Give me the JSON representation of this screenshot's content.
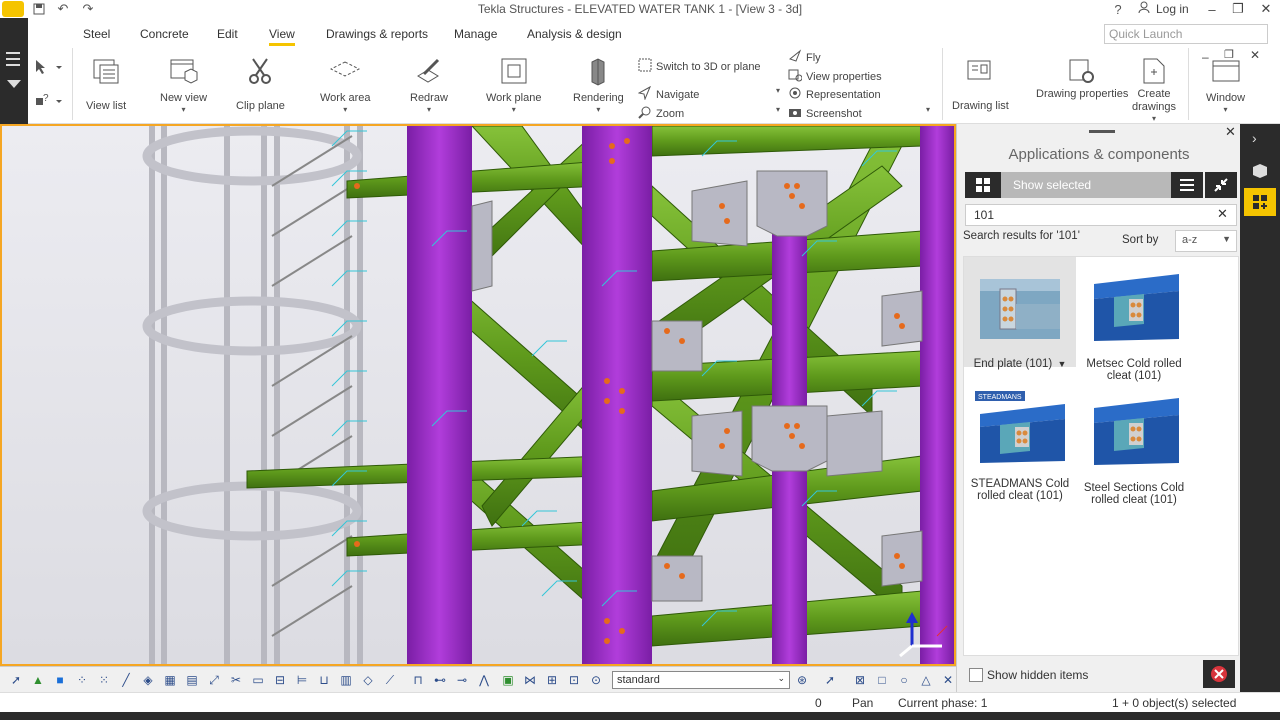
{
  "window": {
    "title": "Tekla Structures - ELEVATED WATER TANK 1 - [View 3 - 3d]",
    "login_label": "Log in",
    "help_label": "?"
  },
  "menu_tabs": [
    "Steel",
    "Concrete",
    "Edit",
    "View",
    "Drawings & reports",
    "Manage",
    "Analysis & design"
  ],
  "active_tab": "View",
  "quick_launch_placeholder": "Quick Launch",
  "ribbon": {
    "view_list": "View list",
    "new_view": "New view",
    "clip_plane": "Clip plane",
    "work_area": "Work area",
    "redraw": "Redraw",
    "work_plane": "Work plane",
    "rendering": "Rendering",
    "switch_3d": "Switch to 3D or plane",
    "navigate": "Navigate",
    "zoom": "Zoom",
    "fly": "Fly",
    "view_properties": "View properties",
    "representation": "Representation",
    "screenshot": "Screenshot",
    "drawing_list": "Drawing list",
    "drawing_properties": "Drawing properties",
    "create_drawings": "Create drawings",
    "window": "Window"
  },
  "panel": {
    "title": "Applications & components",
    "show_selected": "Show selected",
    "search_value": "101",
    "results_label": "Search results for '101'",
    "sort_by_label": "Sort by",
    "sort_value": "a-z",
    "items": [
      {
        "label": "End plate (101)"
      },
      {
        "label": "Metsec Cold rolled cleat (101)"
      },
      {
        "label": "STEADMANS Cold rolled cleat (101)"
      },
      {
        "label": "Steel Sections Cold rolled cleat (101)"
      }
    ],
    "show_hidden": "Show hidden items"
  },
  "bottom_toolbar": {
    "filter_value": "standard"
  },
  "status": {
    "count": "0",
    "mode": "Pan",
    "phase": "Current phase: 1",
    "selection": "1 + 0 object(s) selected"
  },
  "colors": {
    "accent": "#f5c400",
    "beam_green": "#6aa121",
    "column_purple": "#9b2fc2",
    "viewport_border": "#f5a623"
  }
}
